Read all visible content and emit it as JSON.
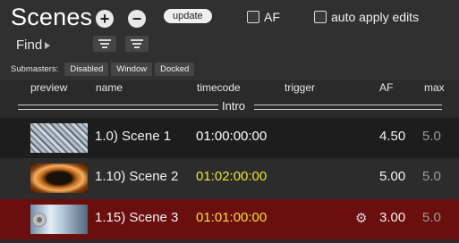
{
  "panel": {
    "title": "Scenes",
    "add_symbol": "+",
    "remove_symbol": "−",
    "update_label": "update",
    "af_label": "AF",
    "auto_apply_label": "auto apply edits",
    "find_label": "Find"
  },
  "submasters": {
    "label": "Submasters:",
    "buttons": [
      "Disabled",
      "Window",
      "Docked"
    ]
  },
  "columns": {
    "preview": "preview",
    "name": "name",
    "timecode": "timecode",
    "trigger": "trigger",
    "af": "AF",
    "max": "max"
  },
  "group": {
    "name": "Intro"
  },
  "scenes": [
    {
      "name": "1.0) Scene 1",
      "timecode": "01:00:00:00",
      "af": "4.50",
      "max": "5.0"
    },
    {
      "name": "1.10) Scene 2",
      "timecode": "01:02:00:00",
      "af": "5.00",
      "max": "5.0"
    },
    {
      "name": "1.15) Scene 3",
      "timecode": "01:01:00:00",
      "af": "3.00",
      "max": "5.0"
    }
  ],
  "icons": {
    "add": "plus-circle-icon",
    "remove": "minus-circle-icon",
    "disclosure": "disclosure-triangle-icon",
    "filter": "filter-icon",
    "gear": "gear-icon",
    "preview_eye": "eye-icon"
  },
  "colors": {
    "timecode_default": "#ffffff",
    "timecode_highlight": "#f2e332",
    "selected_row": "#6b0e0e",
    "row_dark": "#1d1d1d",
    "row_mid": "#2c2c2c"
  }
}
